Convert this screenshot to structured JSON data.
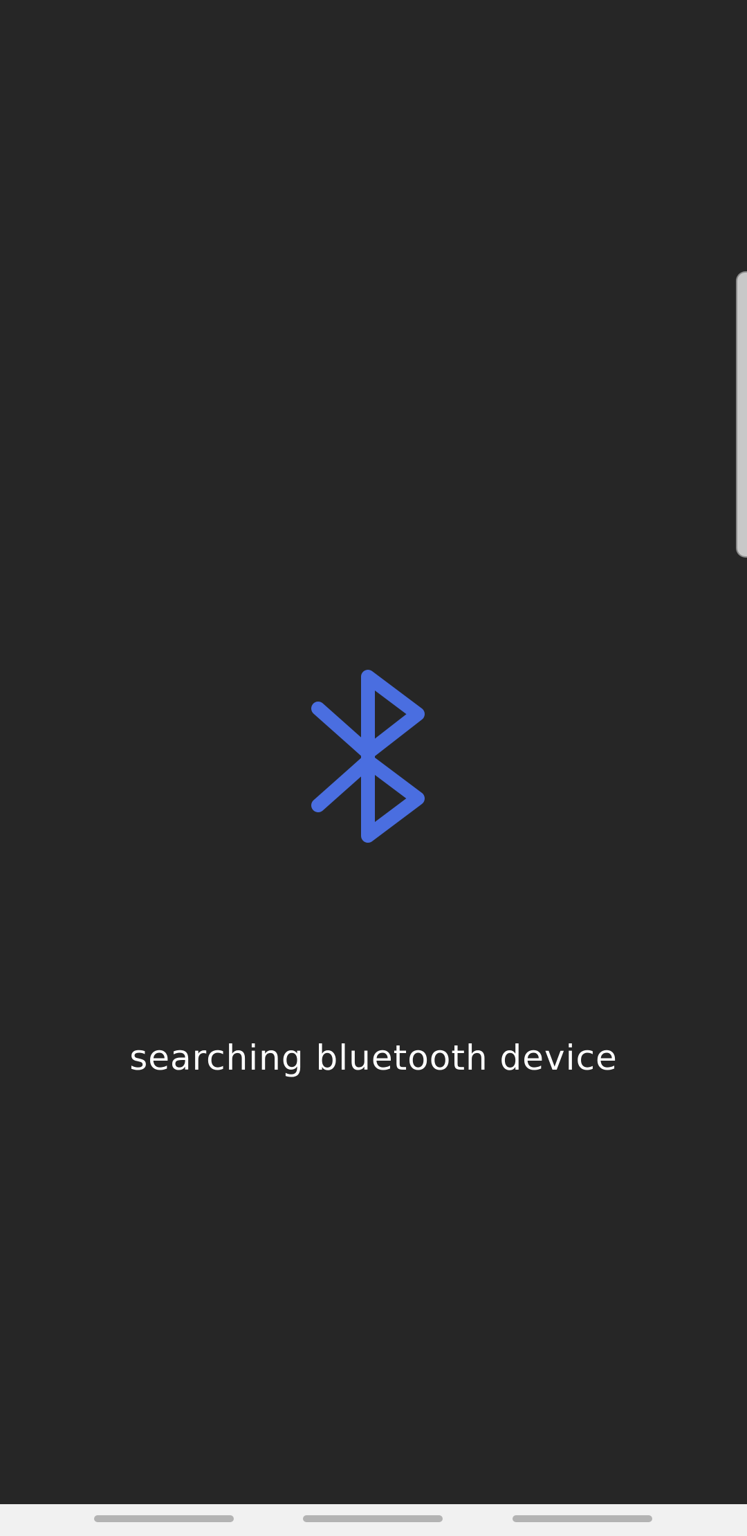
{
  "screen": {
    "status_text": "searching bluetooth device",
    "icon": "bluetooth-icon",
    "colors": {
      "background": "#262626",
      "accent": "#4a6ee0",
      "text": "#ffffff",
      "bottom_bar": "#f1f1f1"
    }
  }
}
